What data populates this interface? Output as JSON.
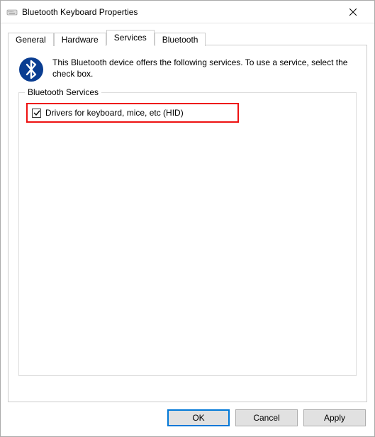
{
  "window": {
    "title": "Bluetooth Keyboard Properties"
  },
  "tabs": {
    "general": "General",
    "hardware": "Hardware",
    "services": "Services",
    "bluetooth": "Bluetooth"
  },
  "panel": {
    "info_text": "This Bluetooth device offers the following services. To use a service, select the check box.",
    "group_title": "Bluetooth Services",
    "service_hid_label": "Drivers for keyboard, mice, etc (HID)",
    "service_hid_checked": true
  },
  "buttons": {
    "ok": "OK",
    "cancel": "Cancel",
    "apply": "Apply"
  }
}
